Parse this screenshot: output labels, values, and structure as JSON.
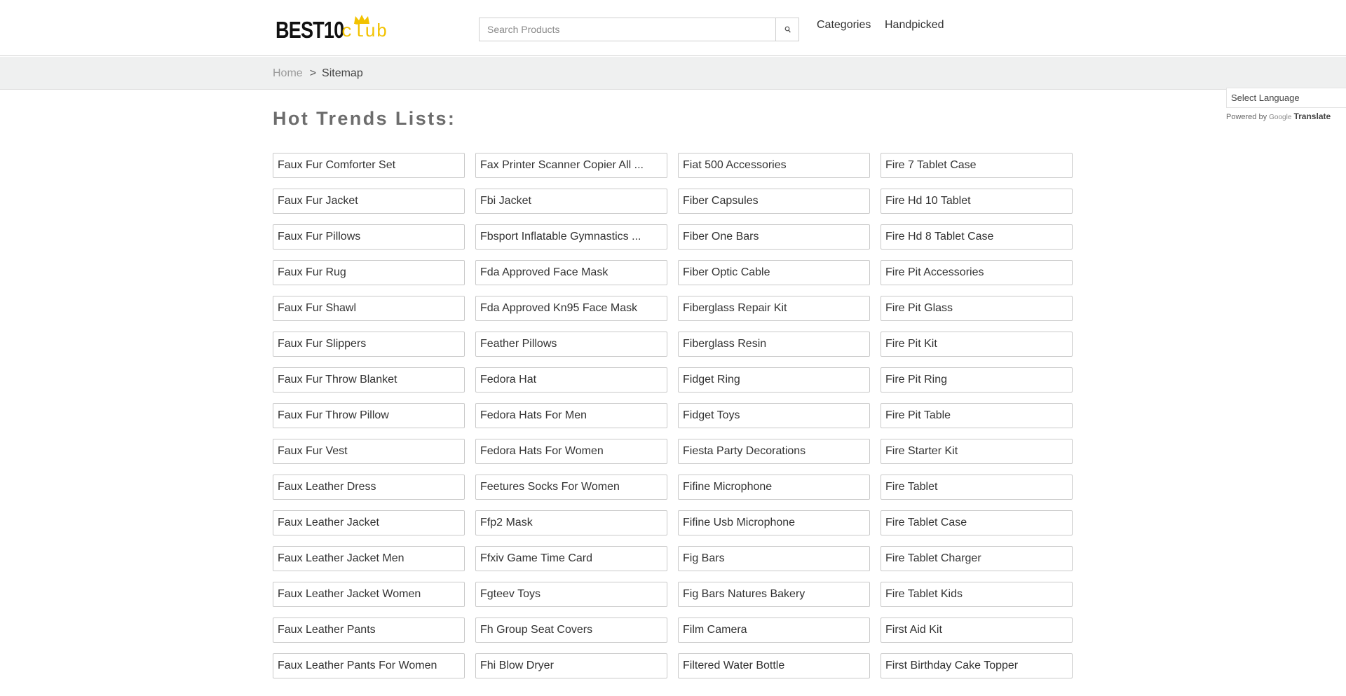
{
  "header": {
    "logo_text": "BEST10",
    "logo_suffix": "club",
    "search_placeholder": "Search Products",
    "nav": [
      "Categories",
      "Handpicked"
    ]
  },
  "breadcrumb": {
    "home": "Home",
    "separator": ">",
    "current": "Sitemap"
  },
  "translate": {
    "select_label": "Select Language",
    "powered_by": "Powered by",
    "google": "Google",
    "translate": "Translate"
  },
  "page": {
    "heading": "Hot Trends Lists:"
  },
  "colors": {
    "logo_accent": "#f2c200",
    "crumb_bar": "#eff0f0",
    "heading": "#6d6d6d"
  },
  "items": [
    "Faux Fur Comforter Set",
    "Fax Printer Scanner Copier All ...",
    "Fiat 500 Accessories",
    "Fire 7 Tablet Case",
    "Faux Fur Jacket",
    "Fbi Jacket",
    "Fiber Capsules",
    "Fire Hd 10 Tablet",
    "Faux Fur Pillows",
    "Fbsport Inflatable Gymnastics ...",
    "Fiber One Bars",
    "Fire Hd 8 Tablet Case",
    "Faux Fur Rug",
    "Fda Approved Face Mask",
    "Fiber Optic Cable",
    "Fire Pit Accessories",
    "Faux Fur Shawl",
    "Fda Approved Kn95 Face Mask",
    "Fiberglass Repair Kit",
    "Fire Pit Glass",
    "Faux Fur Slippers",
    "Feather Pillows",
    "Fiberglass Resin",
    "Fire Pit Kit",
    "Faux Fur Throw Blanket",
    "Fedora Hat",
    "Fidget Ring",
    "Fire Pit Ring",
    "Faux Fur Throw Pillow",
    "Fedora Hats For Men",
    "Fidget Toys",
    "Fire Pit Table",
    "Faux Fur Vest",
    "Fedora Hats For Women",
    "Fiesta Party Decorations",
    "Fire Starter Kit",
    "Faux Leather Dress",
    "Feetures Socks For Women",
    "Fifine Microphone",
    "Fire Tablet",
    "Faux Leather Jacket",
    "Ffp2 Mask",
    "Fifine Usb Microphone",
    "Fire Tablet Case",
    "Faux Leather Jacket Men",
    "Ffxiv Game Time Card",
    "Fig Bars",
    "Fire Tablet Charger",
    "Faux Leather Jacket Women",
    "Fgteev Toys",
    "Fig Bars Natures Bakery",
    "Fire Tablet Kids",
    "Faux Leather Pants",
    "Fh Group Seat Covers",
    "Film Camera",
    "First Aid Kit",
    "Faux Leather Pants For Women",
    "Fhi Blow Dryer",
    "Filtered Water Bottle",
    "First Birthday Cake Topper"
  ]
}
